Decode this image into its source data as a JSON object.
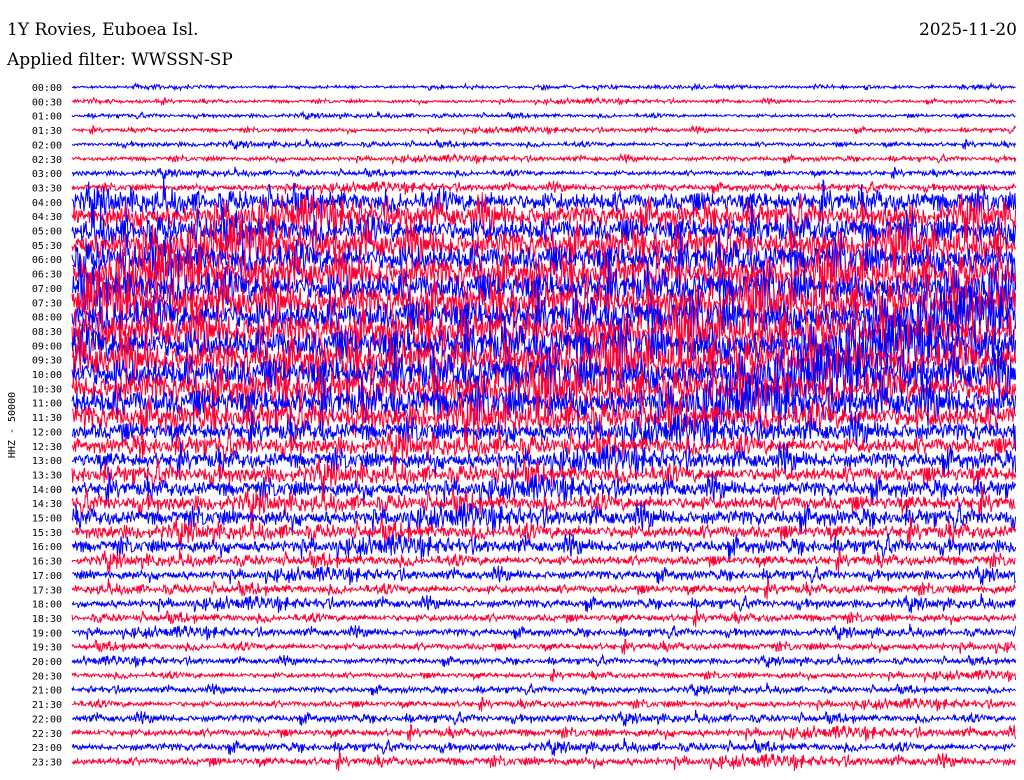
{
  "header": {
    "title": "1Y Rovies, Euboea Isl.",
    "date": "2025-11-20",
    "filter": "Applied filter: WWSSN-SP"
  },
  "chart_data": {
    "type": "line",
    "title": "1Y Rovies, Euboea Isl.",
    "date": "2025-11-20",
    "subtitle": "Applied filter: WWSSN-SP",
    "ylabel": "HHZ - 50000",
    "y_tick_labels": [
      "00:00",
      "00:30",
      "01:00",
      "01:30",
      "02:00",
      "02:30",
      "03:00",
      "03:30",
      "04:00",
      "04:30",
      "05:00",
      "05:30",
      "06:00",
      "06:30",
      "07:00",
      "07:30",
      "08:00",
      "08:30",
      "09:00",
      "09:30",
      "10:00",
      "10:30",
      "11:00",
      "11:30",
      "12:00",
      "12:30",
      "13:00",
      "13:30",
      "14:00",
      "14:30",
      "15:00",
      "15:30",
      "16:00",
      "16:30",
      "17:00",
      "17:30",
      "18:00",
      "18:30",
      "19:00",
      "19:30",
      "20:00",
      "20:30",
      "21:00",
      "21:30",
      "22:00",
      "22:30",
      "23:00",
      "23:30"
    ],
    "series_colors": [
      "#0000ff",
      "#ff0033"
    ],
    "traces": [
      {
        "time": "00:00",
        "amplitude": 0.25
      },
      {
        "time": "00:30",
        "amplitude": 0.25
      },
      {
        "time": "01:00",
        "amplitude": 0.28
      },
      {
        "time": "01:30",
        "amplitude": 0.3
      },
      {
        "time": "02:00",
        "amplitude": 0.35
      },
      {
        "time": "02:30",
        "amplitude": 0.35
      },
      {
        "time": "03:00",
        "amplitude": 0.4
      },
      {
        "time": "03:30",
        "amplitude": 0.5
      },
      {
        "time": "04:00",
        "amplitude": 1.6
      },
      {
        "time": "04:30",
        "amplitude": 1.8
      },
      {
        "time": "05:00",
        "amplitude": 2.0
      },
      {
        "time": "05:30",
        "amplitude": 2.2
      },
      {
        "time": "06:00",
        "amplitude": 2.3
      },
      {
        "time": "06:30",
        "amplitude": 2.5
      },
      {
        "time": "07:00",
        "amplitude": 2.5
      },
      {
        "time": "07:30",
        "amplitude": 2.6
      },
      {
        "time": "08:00",
        "amplitude": 2.6
      },
      {
        "time": "08:30",
        "amplitude": 2.7
      },
      {
        "time": "09:00",
        "amplitude": 2.7
      },
      {
        "time": "09:30",
        "amplitude": 2.7
      },
      {
        "time": "10:00",
        "amplitude": 2.6
      },
      {
        "time": "10:30",
        "amplitude": 2.5
      },
      {
        "time": "11:00",
        "amplitude": 2.3
      },
      {
        "time": "11:30",
        "amplitude": 2.0
      },
      {
        "time": "12:00",
        "amplitude": 1.5
      },
      {
        "time": "12:30",
        "amplitude": 1.4
      },
      {
        "time": "13:00",
        "amplitude": 1.3
      },
      {
        "time": "13:30",
        "amplitude": 1.3
      },
      {
        "time": "14:00",
        "amplitude": 1.2
      },
      {
        "time": "14:30",
        "amplitude": 1.2
      },
      {
        "time": "15:00",
        "amplitude": 1.2
      },
      {
        "time": "15:30",
        "amplitude": 1.1
      },
      {
        "time": "16:00",
        "amplitude": 1.0
      },
      {
        "time": "16:30",
        "amplitude": 0.8
      },
      {
        "time": "17:00",
        "amplitude": 0.7
      },
      {
        "time": "17:30",
        "amplitude": 0.7
      },
      {
        "time": "18:00",
        "amplitude": 0.65
      },
      {
        "time": "18:30",
        "amplitude": 0.6
      },
      {
        "time": "19:00",
        "amplitude": 0.55
      },
      {
        "time": "19:30",
        "amplitude": 0.55
      },
      {
        "time": "20:00",
        "amplitude": 0.45
      },
      {
        "time": "20:30",
        "amplitude": 0.45
      },
      {
        "time": "21:00",
        "amplitude": 0.45
      },
      {
        "time": "21:30",
        "amplitude": 0.5
      },
      {
        "time": "22:00",
        "amplitude": 0.55
      },
      {
        "time": "22:30",
        "amplitude": 0.6
      },
      {
        "time": "23:00",
        "amplitude": 0.6
      },
      {
        "time": "23:30",
        "amplitude": 0.65
      }
    ],
    "x_range_minutes": [
      0,
      30
    ],
    "grid": false,
    "legend": "none"
  }
}
